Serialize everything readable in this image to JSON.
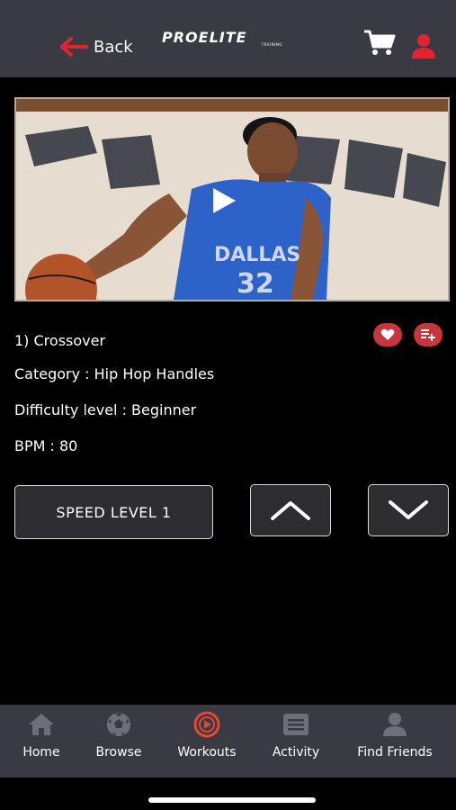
{
  "header": {
    "back_label": "Back",
    "logo_text": "PROELITE",
    "logo_sub": "TRAINING"
  },
  "drill": {
    "title": "1) Crossover",
    "category": "Category : Hip Hop Handles",
    "difficulty": "Difficulty level : Beginner",
    "bpm": "BPM : 80"
  },
  "controls": {
    "speed_label": "SPEED LEVEL 1"
  },
  "tabs": [
    {
      "label": "Home",
      "icon": "home-icon",
      "active": false
    },
    {
      "label": "Browse",
      "icon": "soccer-ball-icon",
      "active": false
    },
    {
      "label": "Workouts",
      "icon": "play-circle-icon",
      "active": true
    },
    {
      "label": "Activity",
      "icon": "list-icon",
      "active": false
    },
    {
      "label": "Find Friends",
      "icon": "person-icon",
      "active": false
    }
  ],
  "colors": {
    "accent": "#e8462f",
    "header_bg": "#3a3b42",
    "action_pill": "#c8353d",
    "back_arrow": "#e0252f",
    "user_icon": "#e0252f",
    "inactive_icon": "#6f7077"
  }
}
